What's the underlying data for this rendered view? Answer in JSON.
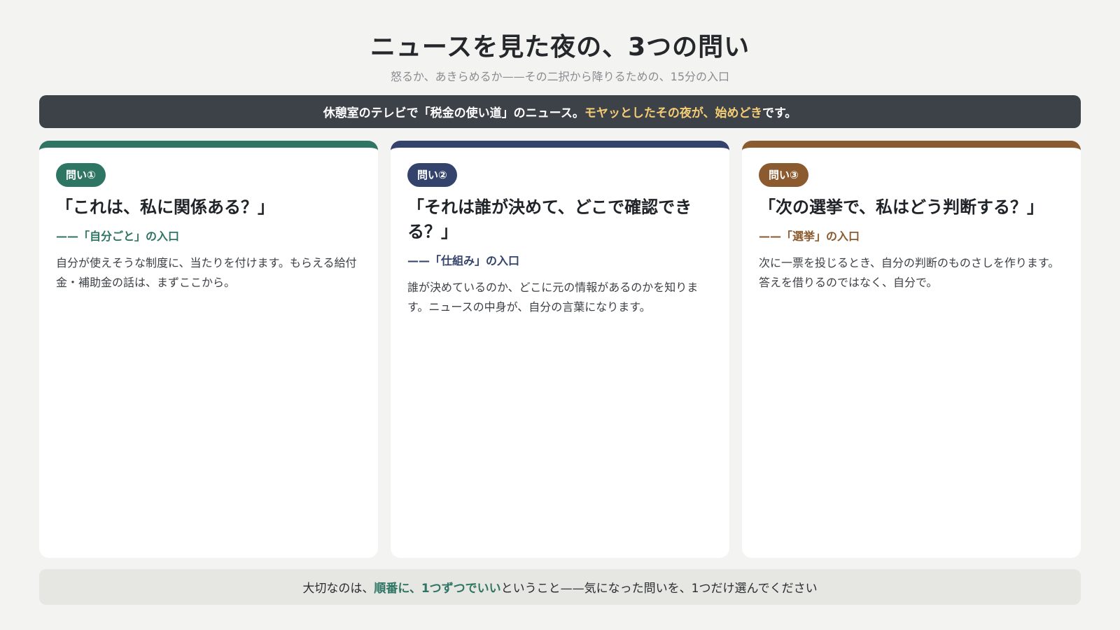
{
  "header": {
    "title": "ニュースを見た夜の、3つの問い",
    "subtitle": "怒るか、あきらめるか——その二択から降りるための、15分の入口"
  },
  "banner": {
    "text_before": "休憩室のテレビで「税金の使い道」のニュース。",
    "highlight": "モヤッとしたその夜が、始めどき",
    "text_after": "です。"
  },
  "cards": [
    {
      "badge": "問い①",
      "question": "「これは、私に関係ある？」",
      "entry": "——「自分ごと」の入口",
      "description": "自分が使えそうな制度に、当たりを付けます。もらえる給付金・補助金の話は、まずここから。",
      "accent": "#2f7563"
    },
    {
      "badge": "問い②",
      "question": "「それは誰が決めて、どこで確認できる？」",
      "entry": "——「仕組み」の入口",
      "description": "誰が決めているのか、どこに元の情報があるのかを知ります。ニュースの中身が、自分の言葉になります。",
      "accent": "#33436b"
    },
    {
      "badge": "問い③",
      "question": "「次の選挙で、私はどう判断する？」",
      "entry": "——「選挙」の入口",
      "description": "次に一票を投じるとき、自分の判断のものさしを作ります。答えを借りるのではなく、自分で。",
      "accent": "#8b5a2e"
    }
  ],
  "footer": {
    "text_before": "大切なのは、",
    "highlight": "順番に、1つずつでいい",
    "text_after": "ということ——気になった問いを、1つだけ選んでください"
  },
  "colors": {
    "background": "#f3f3f2",
    "banner_bg": "#3d4249",
    "banner_highlight": "#f5cd74",
    "footer_bg": "#e6e6e3"
  }
}
